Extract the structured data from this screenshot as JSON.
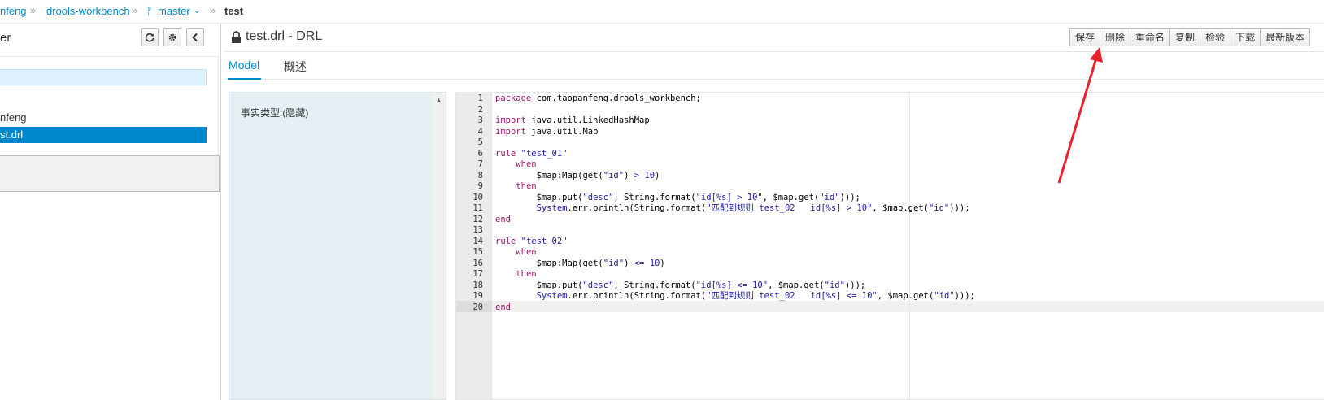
{
  "breadcrumb": {
    "items": [
      "nfeng",
      "drools-workbench",
      "master",
      "test"
    ],
    "separator": "»",
    "branch_icon": "code-branch-icon"
  },
  "left_panel": {
    "title": "er",
    "buttons": [
      "refresh-icon",
      "gear-icon",
      "chevron-left-icon"
    ],
    "tree": {
      "items": [
        "nfeng",
        "st.drl"
      ]
    }
  },
  "editor": {
    "title": "test.drl - DRL",
    "toolbar": [
      "保存",
      "删除",
      "重命名",
      "复制",
      "检验",
      "下载",
      "最新版本"
    ],
    "tabs": [
      "Model",
      "概述"
    ],
    "facts_label": "事实类型:(隐藏)",
    "line_numbers": [
      "1",
      "2",
      "3",
      "4",
      "5",
      "6",
      "7",
      "8",
      "9",
      "10",
      "11",
      "12",
      "13",
      "14",
      "15",
      "16",
      "17",
      "18",
      "19",
      "20"
    ],
    "code_lines": [
      "package com.taopanfeng.drools_workbench;",
      "",
      "import java.util.LinkedHashMap",
      "import java.util.Map",
      "",
      "rule \"test_01\"",
      "    when",
      "        $map:Map(get(\"id\") > 10)",
      "    then",
      "        $map.put(\"desc\", String.format(\"id[%s] > 10\", $map.get(\"id\")));",
      "        System.err.println(String.format(\"匹配到规则 test_02   id[%s] > 10\", $map.get(\"id\")));",
      "end",
      "",
      "rule \"test_02\"",
      "    when",
      "        $map:Map(get(\"id\") <= 10)",
      "    then",
      "        $map.put(\"desc\", String.format(\"id[%s] <= 10\", $map.get(\"id\")));",
      "        System.err.println(String.format(\"匹配到规则 test_02   id[%s] <= 10\", $map.get(\"id\")));",
      "end"
    ]
  },
  "colors": {
    "accent": "#0088ce",
    "keyword": "#931a68",
    "string": "#1a1aa6",
    "annotation_arrow": "#e8202a"
  }
}
